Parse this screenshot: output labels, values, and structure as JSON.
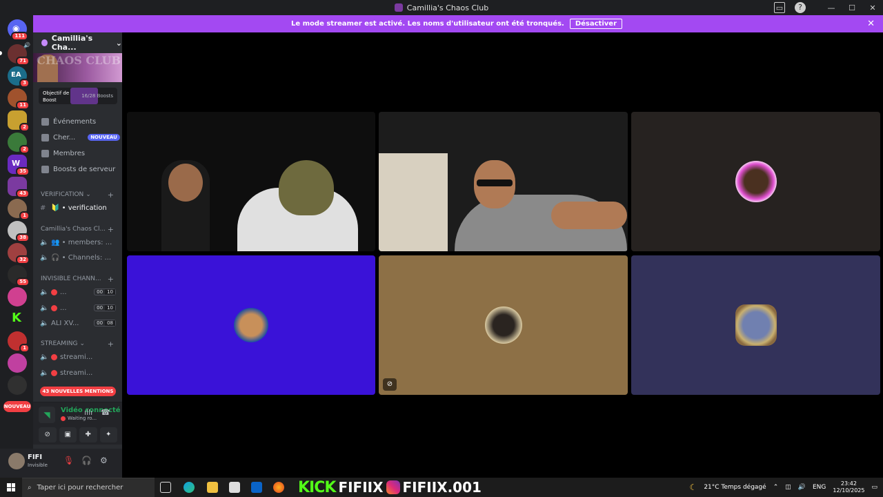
{
  "window": {
    "title": "Camillia's Chaos Club"
  },
  "streamer_banner": {
    "message": "Le mode streamer est activé. Les noms d'utilisateur ont été tronqués.",
    "button": "Désactiver"
  },
  "guilds": {
    "home_badge": "111",
    "badges": [
      "71",
      "3",
      "11",
      "2",
      "2",
      "35",
      "43",
      "1",
      "38",
      "32",
      "55",
      "1"
    ],
    "new_label": "NOUVEAU"
  },
  "server": {
    "name": "Camillia's Cha...",
    "banner_text": "CHAOS CLUB",
    "boost_label": "Objectif de Boost",
    "boost_count": "16/28 Boosts"
  },
  "nav": [
    {
      "label": "Événements",
      "icon": "calendar-icon"
    },
    {
      "label": "Cher...",
      "icon": "search-icon",
      "pill": "NOUVEAU"
    },
    {
      "label": "Membres",
      "icon": "members-icon"
    },
    {
      "label": "Boosts de serveur",
      "icon": "boost-icon"
    }
  ],
  "categories": {
    "verification": "VERIFICATION",
    "camillia": "Camillia's Chaos Cl...",
    "invisible": "INVISIBLE CHANN...",
    "streaming": "STREAMING"
  },
  "channels": {
    "verification": "🔰 • verification",
    "members": "👥 • members: ...",
    "channels": "🎧 • Channels: ...",
    "inv1": "...",
    "inv1_a": "00",
    "inv1_b": "10",
    "inv2": "...",
    "inv2_a": "00",
    "inv2_b": "10",
    "inv3": "ALI XV...",
    "inv3_a": "00",
    "inv3_b": "08",
    "stream1": "streami...",
    "stream2": "streami..."
  },
  "mentions": "43 NOUVELLES MENTIONS",
  "voice": {
    "status": "Vidéo connecté",
    "sub": "Waiting ro..."
  },
  "user": {
    "name": "FIFI",
    "status": "Invisible"
  },
  "tiles": [
    {
      "name": "two-people-camera",
      "bg": "#101010"
    },
    {
      "name": "man-headset-camera",
      "bg": "#202020"
    },
    {
      "name": "avatar-tile-dark",
      "bg": "#262220"
    },
    {
      "name": "avatar-tile-blue",
      "bg": "#3a12d8"
    },
    {
      "name": "avatar-tile-tan",
      "bg": "#8d7046"
    },
    {
      "name": "avatar-tile-slate",
      "bg": "#33325a"
    }
  ],
  "taskbar": {
    "search_placeholder": "Taper ici pour rechercher",
    "kick_label": "KICK",
    "kick_name": "FIFIIX",
    "ig_name": "FIFIIX.001",
    "weather": "21°C  Temps dégagé",
    "lang": "ENG",
    "time": "23:42",
    "date": "12/10/2025"
  }
}
